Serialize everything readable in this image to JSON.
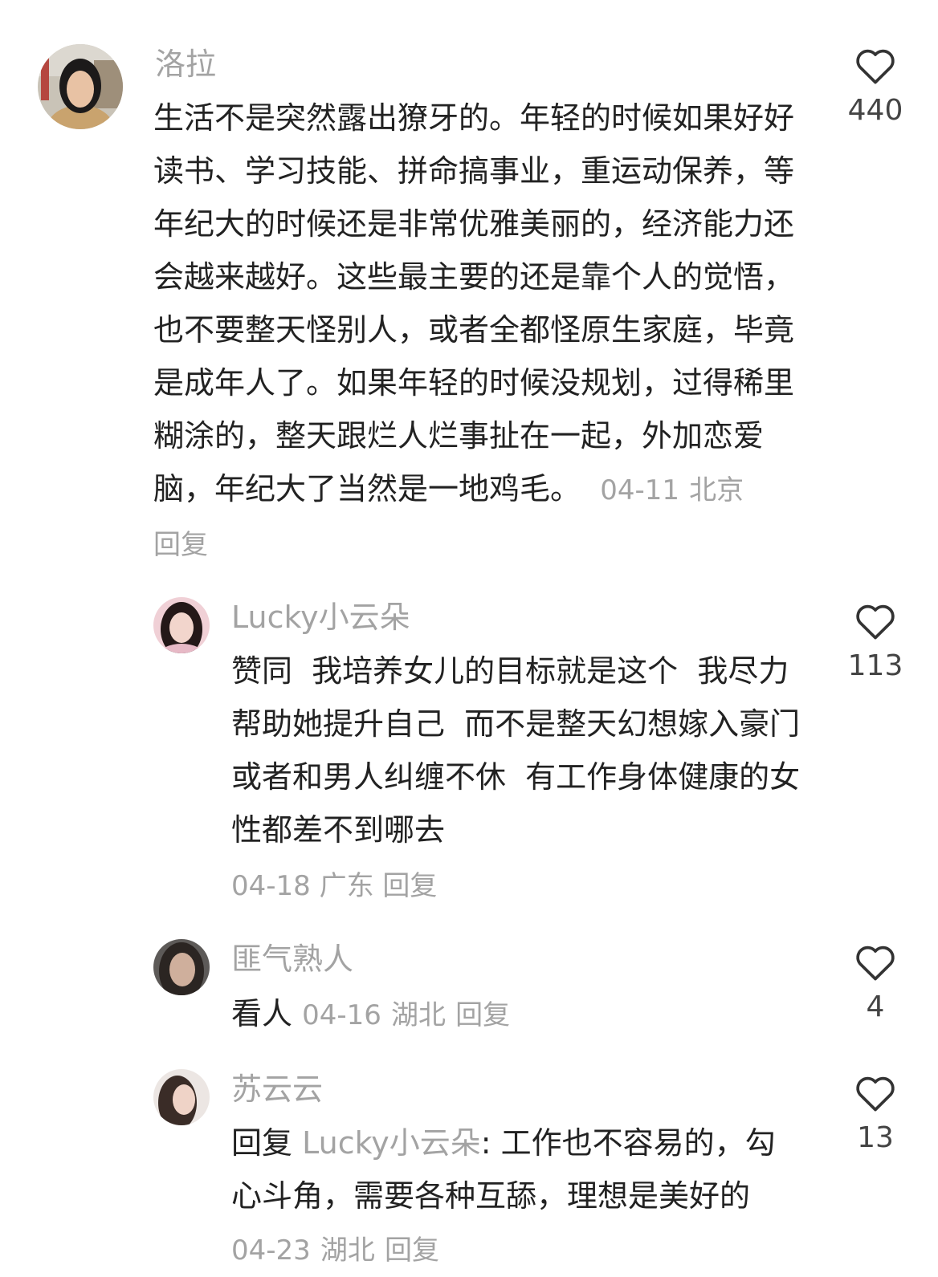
{
  "comments": [
    {
      "username": "洛拉",
      "text": "生活不是突然露出獠牙的。年轻的时候如果好好读书、学习技能、拼命搞事业，重运动保养，等年纪大的时候还是非常优雅美丽的，经济能力还会越来越好。这些最主要的还是靠个人的觉悟，也不要整天怪别人，或者全都怪原生家庭，毕竟是成年人了。如果年轻的时候没规划，过得稀里糊涂的，整天跟烂人烂事扯在一起，外加恋爱脑，年纪大了当然是一地鸡毛。",
      "date": "04-11",
      "location": "北京",
      "reply_label": "回复",
      "like_count": "440",
      "like_icon": "heart-outline-icon"
    },
    {
      "username": "Lucky小云朵",
      "text": "赞同  我培养女儿的目标就是这个  我尽力帮助她提升自己  而不是整天幻想嫁入豪门或者和男人纠缠不休  有工作身体健康的女性都差不到哪去",
      "date": "04-18",
      "location": "广东",
      "reply_label": "回复",
      "like_count": "113",
      "like_icon": "heart-outline-icon"
    },
    {
      "username": "匪气熟人",
      "text": "看人",
      "date": "04-16",
      "location": "湖北",
      "reply_label": "回复",
      "like_count": "4",
      "like_icon": "heart-outline-icon"
    },
    {
      "username": "苏云云",
      "reply_prefix": "回复",
      "reply_to": "Lucky小云朵",
      "text": ": 工作也不容易的，勾心斗角，需要各种互舔，理想是美好的",
      "date": "04-23",
      "location": "湖北",
      "reply_label": "回复",
      "like_count": "13",
      "like_icon": "heart-outline-icon"
    }
  ],
  "colors": {
    "primary_text": "#222222",
    "secondary_text": "#a3a3a3",
    "like_count": "#444444",
    "background": "#ffffff"
  }
}
